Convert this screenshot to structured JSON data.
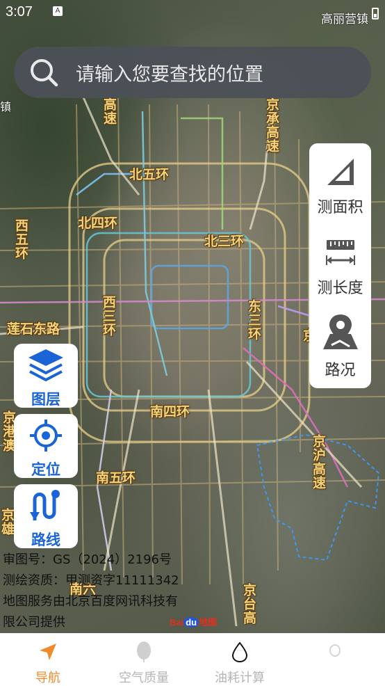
{
  "status_bar": {
    "time": "3:07",
    "note_glyph": "A"
  },
  "map": {
    "top_label": "高丽营镇",
    "left_edge_label": "镇",
    "road_labels": {
      "g_gaosu_top": "高速",
      "jingcheng": "京承高速",
      "bei_wu_huan": "北五环",
      "bei_si_huan": "北四环",
      "bei_san_huan": "北三环",
      "xi_wu_huan": "西五环",
      "xi_san_huan": "西三环",
      "dong_san_huan": "东三环",
      "lianshi_dong_lu": "莲石东路",
      "jingguang": "京",
      "nan_si_huan": "南四环",
      "nan_wu_huan": "南五环",
      "nan_liu_huan": "南六",
      "jinghu_gaosu": "京沪高速",
      "jingtai_gaosu": "京台高",
      "jinggang": "京港澳",
      "jingxiong": "京雄"
    }
  },
  "search": {
    "placeholder": "请输入您要查找的位置"
  },
  "tools": {
    "area": "测面积",
    "length": "测长度",
    "traffic": "路况"
  },
  "left_buttons": {
    "layers": "图层",
    "locate": "定位",
    "route": "路线"
  },
  "copyright": {
    "line1": "审图号：GS（2024）2196号",
    "line2": "测绘资质：甲测资字11111342",
    "line3": "地图服务由北京百度网讯科技有",
    "line4": "限公司提供",
    "logo_bai": "Bai",
    "logo_du": "du",
    "logo_cn": "地图"
  },
  "bottom_nav": {
    "items": [
      {
        "label": "导航",
        "active": true
      },
      {
        "label": "空气质量",
        "active": false
      },
      {
        "label": "油耗计算",
        "active": false
      },
      {
        "label": "",
        "active": false
      }
    ]
  },
  "colors": {
    "accent_blue": "#1a64d8",
    "active_orange": "#f08a2c",
    "inactive_gray": "#b5b5b5",
    "road_label": "#f5d37a"
  }
}
